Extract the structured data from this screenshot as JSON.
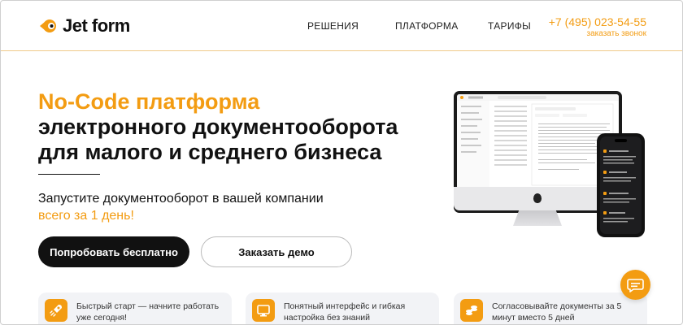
{
  "header": {
    "logo_text": "Jet form",
    "nav": [
      "РЕШЕНИЯ",
      "ПЛАТФОРМА",
      "ТАРИФЫ"
    ],
    "phone": "+7 (495) 023-54-55",
    "call_request": "заказать звонок"
  },
  "hero": {
    "title_accent": "No-Code платформа",
    "title_line2": "электронного документооборота",
    "title_line3": "для малого и среднего бизнеса",
    "subtitle_line1": "Запустите документооборот в вашей компании",
    "subtitle_accent": "всего за 1 день!",
    "cta_primary": "Попробовать бесплатно",
    "cta_secondary": "Заказать демо"
  },
  "features": [
    {
      "text": "Быстрый старт — начните работать уже сегодня!",
      "icon": "rocket-icon"
    },
    {
      "text": "Понятный интерфейс и гибкая настройка без знаний программирования",
      "icon": "interface-icon"
    },
    {
      "text": "Согласовывайте документы за 5 минут вместо 5 дней",
      "icon": "coins-icon"
    }
  ],
  "colors": {
    "accent": "#f39c12",
    "text": "#111111",
    "card_bg": "#f2f3f6"
  }
}
